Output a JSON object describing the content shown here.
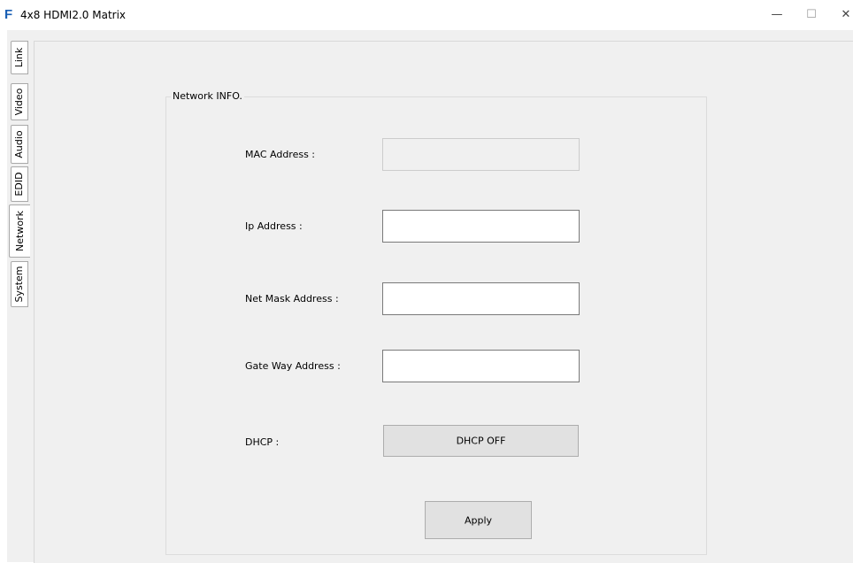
{
  "window": {
    "logo": "F",
    "title": "4x8 HDMI2.0 Matrix",
    "minimize": "—",
    "maximize": "☐",
    "close": "✕"
  },
  "tabs": [
    {
      "label": "Link",
      "active": false
    },
    {
      "label": "Video",
      "active": false
    },
    {
      "label": "Audio",
      "active": false
    },
    {
      "label": "EDID",
      "active": false
    },
    {
      "label": "Network",
      "active": true
    },
    {
      "label": "System",
      "active": false
    }
  ],
  "network": {
    "group_title": "Network INFO.",
    "mac_label": "MAC Address :",
    "mac_value": "",
    "ip_label": "Ip Address :",
    "ip_value": "",
    "mask_label": "Net Mask Address :",
    "mask_value": "",
    "gateway_label": "Gate Way Address :",
    "gateway_value": "",
    "dhcp_label": "DHCP :",
    "dhcp_button": "DHCP OFF",
    "apply_button": "Apply"
  }
}
